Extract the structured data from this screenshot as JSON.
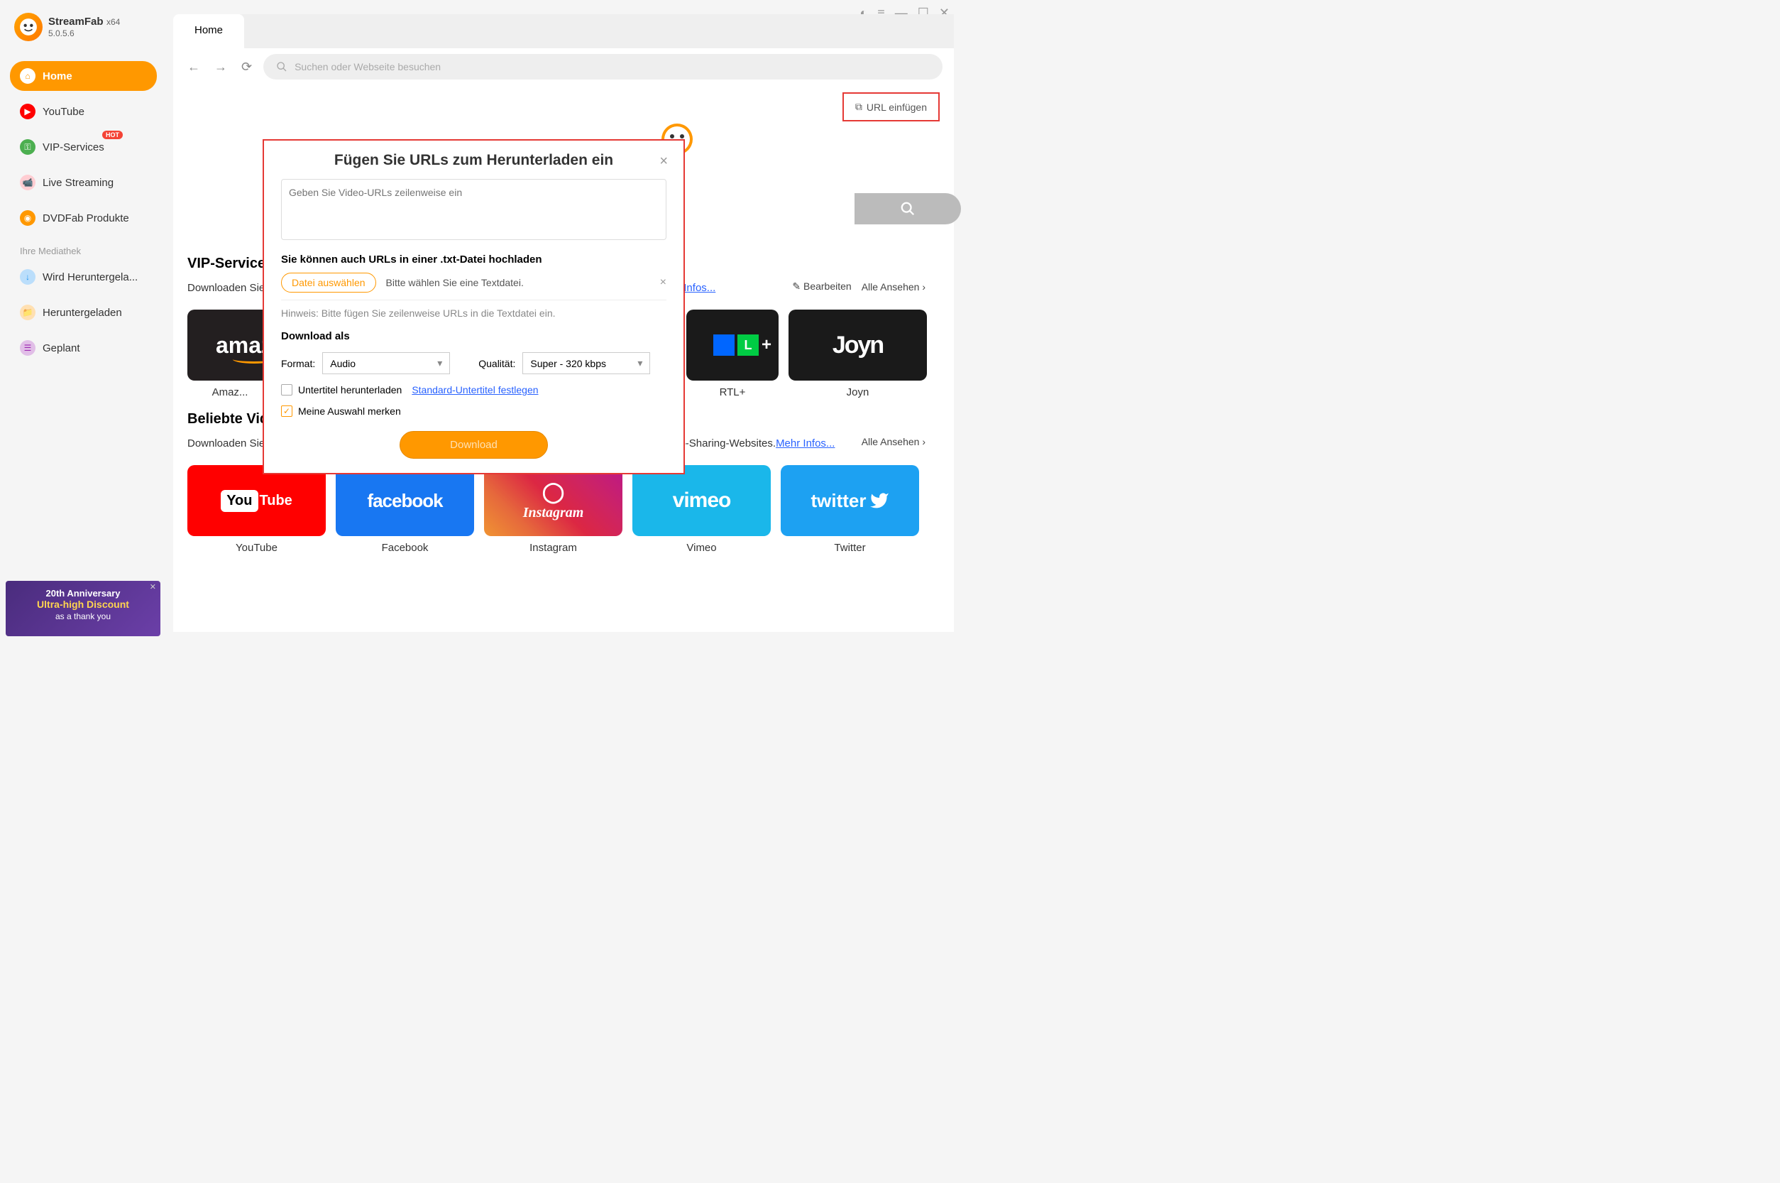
{
  "app": {
    "name": "StreamFab",
    "arch": "x64",
    "version": "5.0.5.6"
  },
  "sidebar": {
    "items": [
      {
        "label": "Home",
        "icon": "home",
        "icon_bg": "#fff",
        "icon_color": "#ff9800"
      },
      {
        "label": "YouTube",
        "icon": "play",
        "icon_bg": "#ff0000"
      },
      {
        "label": "VIP-Services",
        "icon": "key",
        "icon_bg": "#4caf50"
      },
      {
        "label": "Live Streaming",
        "icon": "cam",
        "icon_bg": "#e91e63"
      },
      {
        "label": "DVDFab Produkte",
        "icon": "disc",
        "icon_bg": "#ff9800"
      }
    ],
    "hot_badge": "HOT",
    "section_label": "Ihre Mediathek",
    "library": [
      {
        "label": "Wird Heruntergela...",
        "icon": "down",
        "icon_bg": "#2196f3"
      },
      {
        "label": "Heruntergeladen",
        "icon": "folder",
        "icon_bg": "#ff9800"
      },
      {
        "label": "Geplant",
        "icon": "cal",
        "icon_bg": "#9c27b0"
      }
    ]
  },
  "promo": {
    "line1": "20th Anniversary",
    "line2": "Ultra-high Discount",
    "line3": "as a thank you"
  },
  "tabs": {
    "home": "Home"
  },
  "address_placeholder": "Suchen oder Webseite besuchen",
  "url_paste_button": "URL einfügen",
  "vip_section": {
    "title": "VIP-Services",
    "sub_prefix": "Downloaden Sie ",
    "more_info": "ehr Infos...",
    "edit": "Bearbeiten",
    "view_all": "Alle Ansehen",
    "tiles": [
      {
        "label": "Amaz...",
        "bg": "#231f20",
        "logo_text": "amaz",
        "logo_style": "amazon"
      },
      {
        "label": "RTL+",
        "bg": "#1a1a1a",
        "logo_text": "L +",
        "logo_style": "rtl"
      },
      {
        "label": "Joyn",
        "bg": "#1a1a1a",
        "logo_text": "joyn",
        "logo_style": "joyn"
      }
    ]
  },
  "popular_section": {
    "title": "Beliebte Vide",
    "sub_prefix": "Downloaden Sie ",
    "sub_suffix": "ideo-Sharing-Websites.",
    "more_info": "Mehr Infos...",
    "view_all": "Alle Ansehen",
    "tiles": [
      {
        "label": "YouTube",
        "bg": "#ff0000",
        "logo_text": "YouTube"
      },
      {
        "label": "Facebook",
        "bg": "#1877f2",
        "logo_text": "facebook"
      },
      {
        "label": "Instagram",
        "bg": "linear-gradient(45deg,#f09433,#e6683c,#dc2743,#cc2366,#bc1888)",
        "logo_text": "Instagram"
      },
      {
        "label": "Vimeo",
        "bg": "#1ab7ea",
        "logo_text": "vimeo"
      },
      {
        "label": "Twitter",
        "bg": "#1da1f2",
        "logo_text": "twitter"
      }
    ]
  },
  "modal": {
    "title": "Fügen Sie URLs zum Herunterladen ein",
    "url_placeholder": "Geben Sie Video-URLs zeilenweise ein",
    "upload_label": "Sie können auch URLs in einer .txt-Datei hochladen",
    "file_button": "Datei auswählen",
    "file_hint": "Bitte wählen Sie eine Textdatei.",
    "hint": "Hinweis: Bitte fügen Sie zeilenweise URLs in die Textdatei ein.",
    "download_as": "Download als",
    "format_label": "Format:",
    "format_value": "Audio",
    "quality_label": "Qualität:",
    "quality_value": "Super - 320 kbps",
    "subtitle_check": "Untertitel herunterladen",
    "subtitle_link": "Standard-Untertitel festlegen",
    "remember_check": "Meine Auswahl merken",
    "download_button": "Download"
  }
}
